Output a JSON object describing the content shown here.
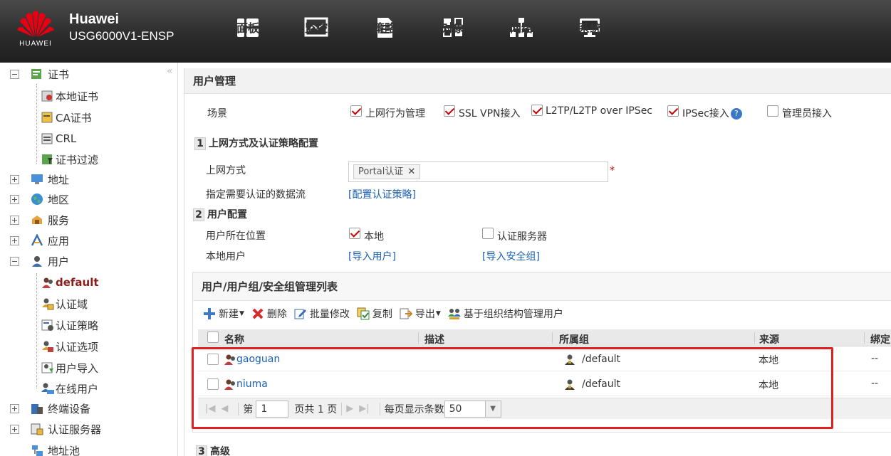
{
  "header": {
    "logo_text": "HUAWEI",
    "brand_name": "Huawei",
    "model": "USG6000V1-ENSP",
    "nav": [
      {
        "label": "面板",
        "icon": "dashboard-icon"
      },
      {
        "label": "监控",
        "icon": "monitor-icon"
      },
      {
        "label": "策略",
        "icon": "policy-icon"
      },
      {
        "label": "对象",
        "icon": "object-icon",
        "active": true
      },
      {
        "label": "网络",
        "icon": "network-icon"
      },
      {
        "label": "系统",
        "icon": "system-icon"
      }
    ]
  },
  "sidebar": {
    "collapse_glyph": "«",
    "cert": "证书",
    "cert_children": [
      "本地证书",
      "CA证书",
      "CRL",
      "证书过滤"
    ],
    "address": "地址",
    "region": "地区",
    "service": "服务",
    "app": "应用",
    "user": "用户",
    "user_children": [
      "default",
      "认证域",
      "认证策略",
      "认证选项",
      "用户导入",
      "在线用户"
    ],
    "terminal": "终端设备",
    "auth_server": "认证服务器",
    "addr_pool": "地址池"
  },
  "main": {
    "title": "用户管理",
    "scene_label": "场景",
    "scenes": [
      {
        "label": "上网行为管理",
        "checked": true
      },
      {
        "label": "SSL VPN接入",
        "checked": true
      },
      {
        "label": "L2TP/L2TP over IPSec",
        "checked": true
      },
      {
        "label": "IPSec接入",
        "checked": true
      },
      {
        "label": "管理员接入",
        "checked": false
      }
    ],
    "help_glyph": "?",
    "s1_num": "1",
    "s1_title": "上网方式及认证策略配置",
    "access_label": "上网方式",
    "access_tag": "Portal认证",
    "tag_close": "✕",
    "required_mark": "*",
    "flow_label": "指定需要认证的数据流",
    "flow_link": "[配置认证策略]",
    "s2_num": "2",
    "s2_title": "用户配置",
    "location_label": "用户所在位置",
    "loc_local": "本地",
    "loc_server": "认证服务器",
    "local_user_label": "本地用户",
    "import_user": "[导入用户]",
    "import_group": "[导入安全组]",
    "s3_num": "3",
    "s3_title": "高级"
  },
  "table": {
    "title": "用户/用户组/安全组管理列表",
    "toolbar": [
      "新建",
      "删除",
      "批量修改",
      "复制",
      "导出",
      "基于组织结构管理用户"
    ],
    "columns": [
      "名称",
      "描述",
      "所属组",
      "来源",
      "绑定"
    ],
    "rows": [
      {
        "name": "gaoguan",
        "desc": "",
        "group": "/default",
        "source": "本地",
        "bind": "--"
      },
      {
        "name": "niuma",
        "desc": "",
        "group": "/default",
        "source": "本地",
        "bind": "--"
      }
    ],
    "pager": {
      "first": "|◀",
      "prev": "◀",
      "next": "▶",
      "last": "▶|",
      "page_prefix": "第",
      "page": "1",
      "page_suffix": "页共 1 页",
      "per_page_label": "每页显示条数",
      "per_page": "50",
      "dropdown_glyph": "▼"
    }
  },
  "colors": {
    "accent_red": "#e02020",
    "link": "#1a5fb4",
    "header_bg": "#2a2a2a"
  }
}
